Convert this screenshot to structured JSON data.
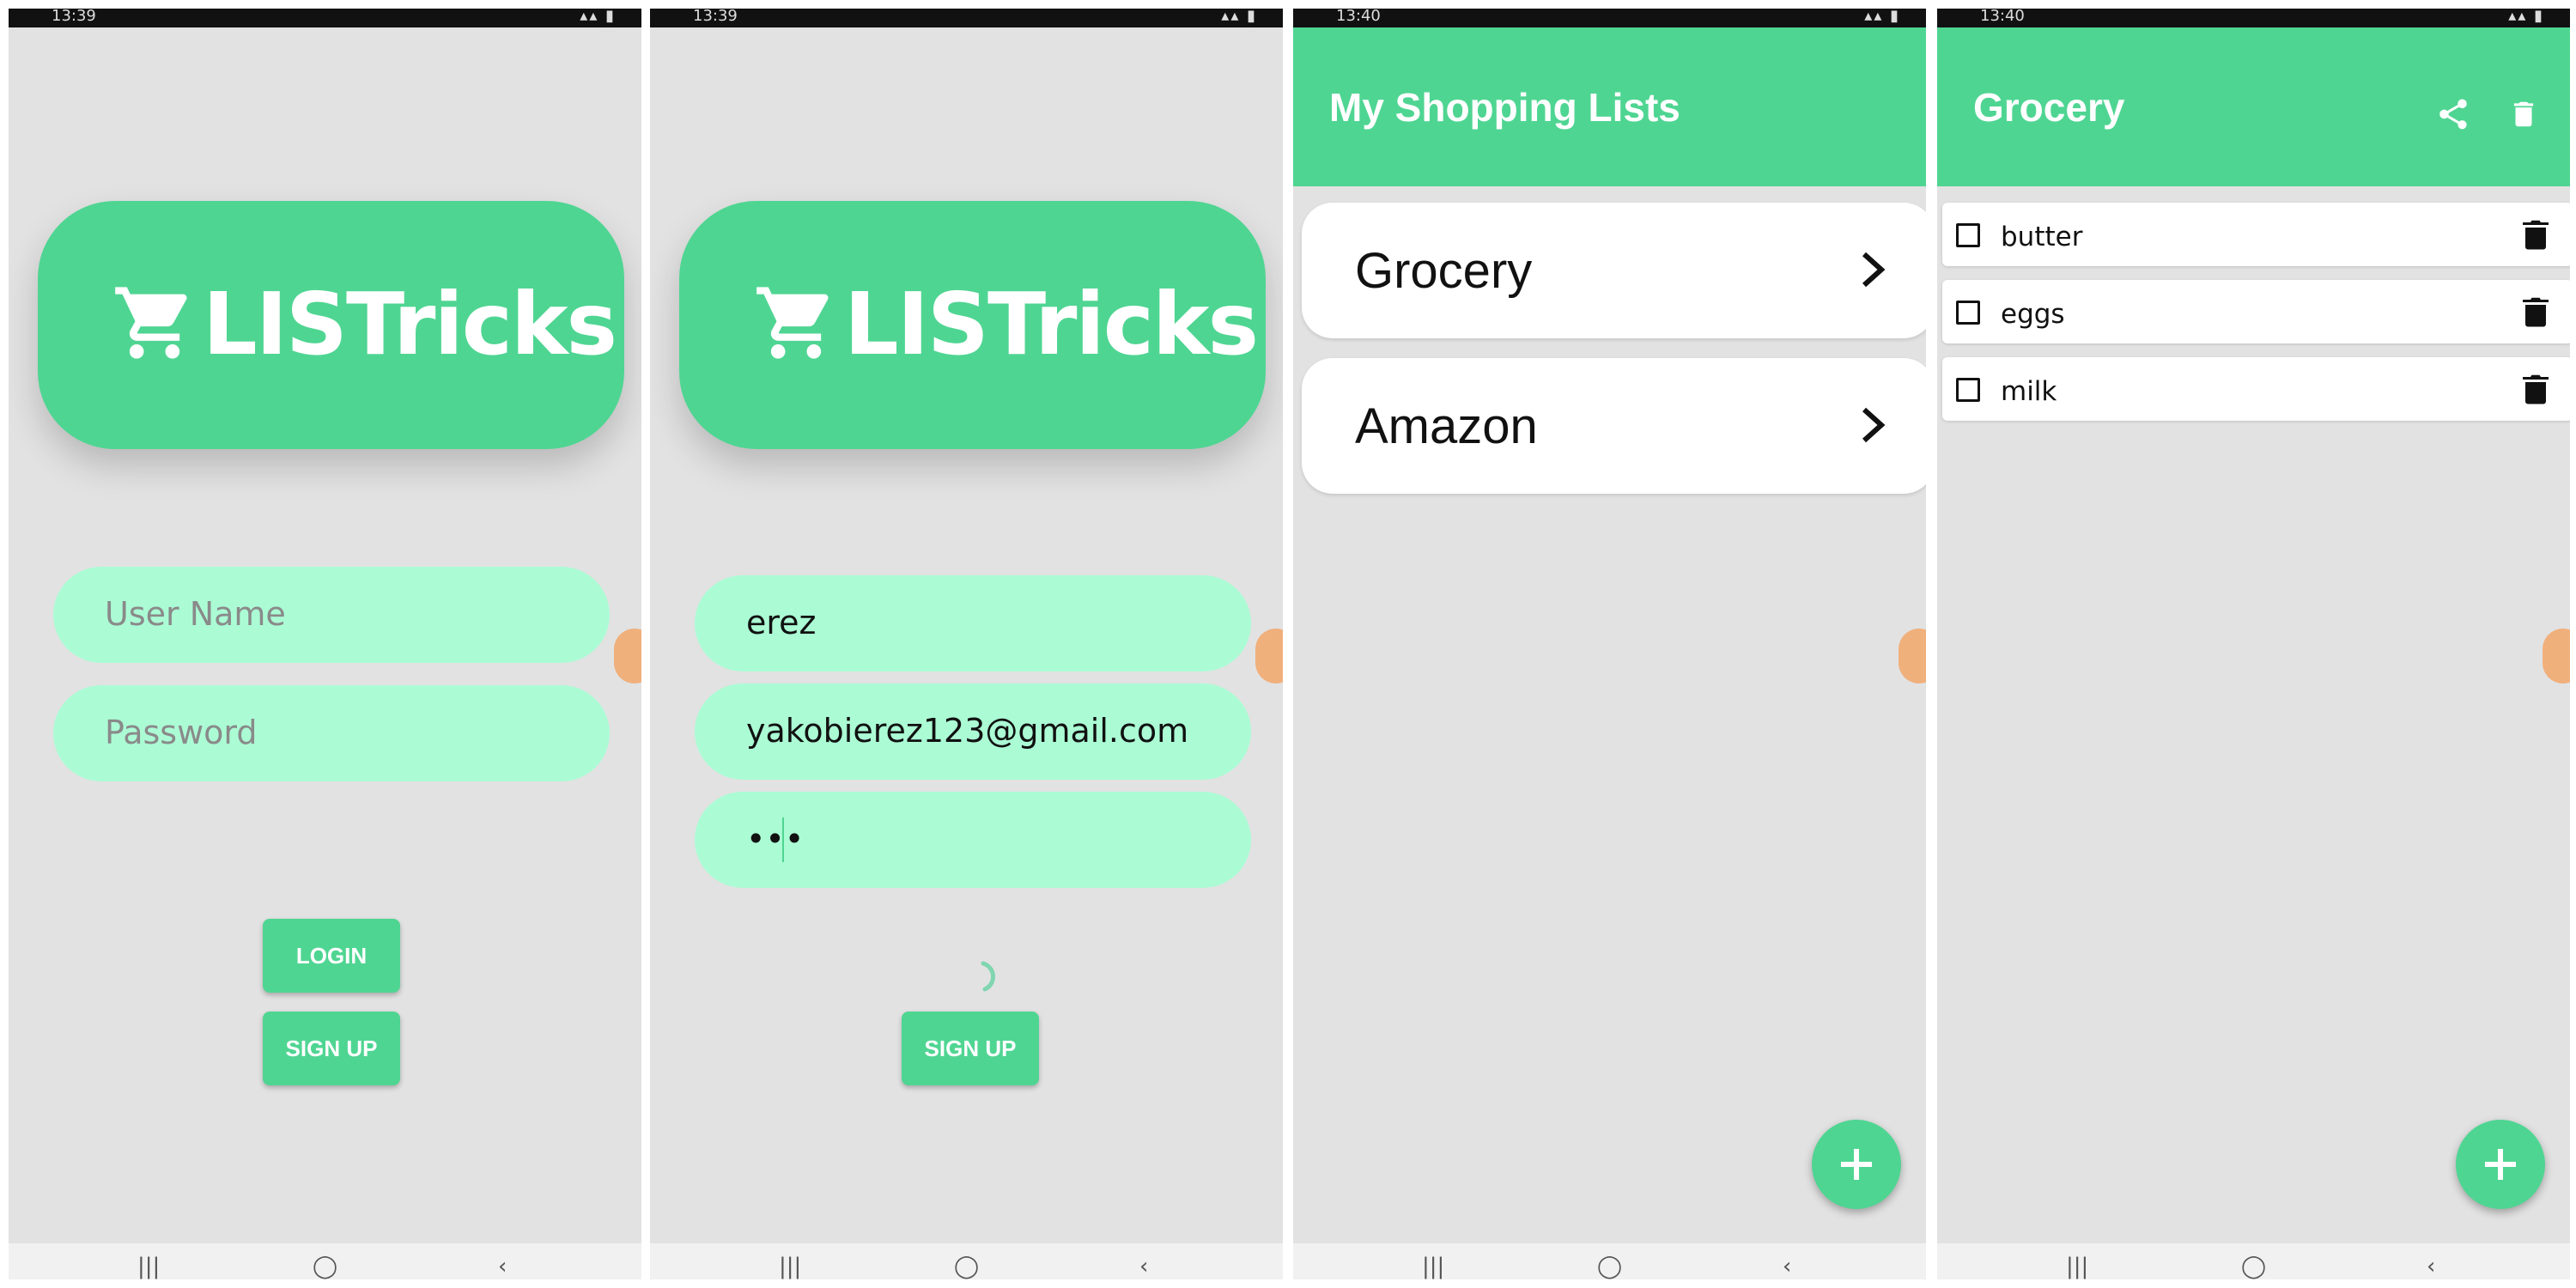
{
  "status_bar": {
    "screen1_time": "13:39",
    "screen2_time": "13:39",
    "screen3_time": "13:40",
    "screen4_time": "13:40",
    "icons": [
      "notification-icons",
      "signal-icons",
      "battery-icon"
    ]
  },
  "brand": {
    "name": "LISTricks",
    "icon": "cart-icon",
    "color": "#4fd592"
  },
  "login_screen": {
    "username_placeholder": "User Name",
    "password_placeholder": "Password",
    "login_label": "LOGIN",
    "signup_label": "SIGN UP"
  },
  "signup_screen": {
    "username_value": "erez",
    "email_value": "yakobierez123@gmail.com",
    "password_value": "•••",
    "signup_label": "SIGN UP"
  },
  "lists_screen": {
    "title": "My Shopping Lists",
    "lists": [
      {
        "label": "Grocery"
      },
      {
        "label": "Amazon"
      }
    ]
  },
  "grocery_screen": {
    "title": "Grocery",
    "items": [
      {
        "label": "butter",
        "checked": false
      },
      {
        "label": "eggs",
        "checked": false
      },
      {
        "label": "milk",
        "checked": false
      }
    ]
  },
  "nav_bar": {
    "recents": "|||",
    "home": "◯",
    "back": "‹"
  }
}
